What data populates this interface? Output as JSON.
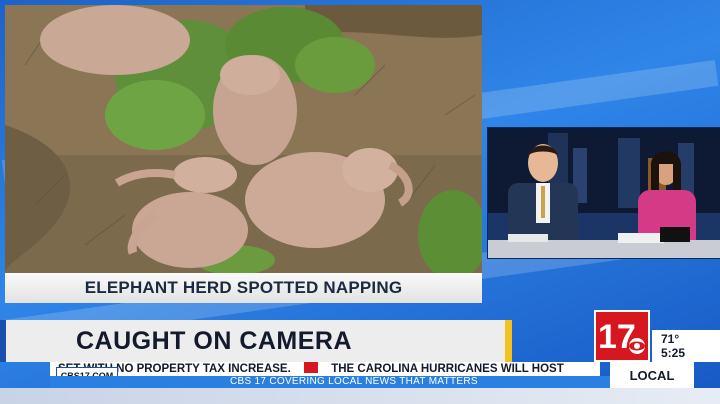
{
  "story": {
    "caption": "ELEPHANT HERD SPOTTED NAPPING",
    "headline": "CAUGHT ON CAMERA"
  },
  "station": {
    "logo_number": "17",
    "url": "CBS17.COM",
    "section": "LOCAL"
  },
  "weather": {
    "temperature": "71°",
    "time": "5:25"
  },
  "ticker": {
    "item_1": "SET WITH NO PROPERTY TAX INCREASE.",
    "item_2": "THE CAROLINA HURRICANES WILL HOST",
    "tagline": "CBS 17 COVERING LOCAL NEWS THAT MATTERS"
  },
  "colors": {
    "brand_red": "#d7171f",
    "brand_blue": "#1a4fb0",
    "accent_yellow": "#f4c21f"
  }
}
